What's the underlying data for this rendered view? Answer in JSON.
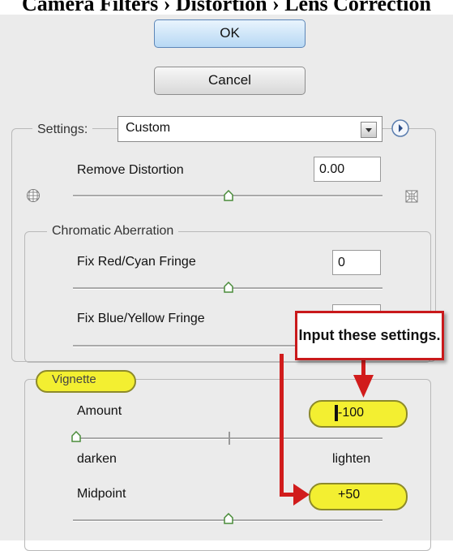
{
  "header": {
    "title": "Camera Filters › Distortion › Lens Correction"
  },
  "buttons": {
    "ok": "OK",
    "cancel": "Cancel"
  },
  "settings": {
    "label": "Settings:",
    "value": "Custom"
  },
  "remove_distortion": {
    "label": "Remove Distortion",
    "value": "0.00",
    "slider": 0.5
  },
  "chromatic": {
    "title": "Chromatic Aberration",
    "red_cyan": {
      "label": "Fix Red/Cyan Fringe",
      "value": "0",
      "slider": 0.5
    },
    "blue_yellow": {
      "label": "Fix Blue/Yellow Fringe",
      "value": "",
      "slider": 0.5
    }
  },
  "vignette": {
    "title": "Vignette",
    "amount": {
      "label": "Amount",
      "value": "-100",
      "slider": 0.0,
      "left_label": "darken",
      "right_label": "lighten"
    },
    "midpoint": {
      "label": "Midpoint",
      "value": "+50",
      "slider": 0.5
    }
  },
  "annotation": {
    "text": "Input these settings."
  },
  "colors": {
    "highlight": "#f3ef31",
    "callout_border": "#c9191b",
    "ok_button": "#b7d8f4"
  },
  "icons": [
    "grid-sphere-icon",
    "grid-square-icon",
    "dropdown-arrow-icon",
    "panel-menu-icon",
    "slider-thumb-icon"
  ]
}
